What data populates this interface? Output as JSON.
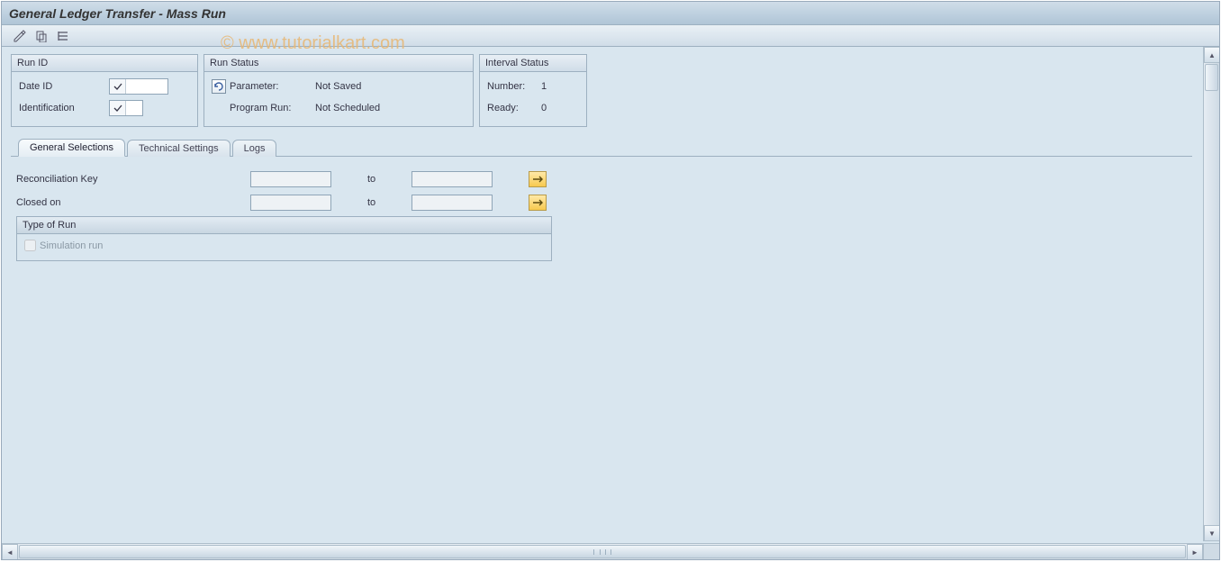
{
  "title": "General Ledger Transfer - Mass Run",
  "watermark": "© www.tutorialkart.com",
  "toolbar": {
    "icon1_name": "pencil-selection-icon",
    "icon2_name": "copy-icon",
    "icon3_name": "expand-icon"
  },
  "panels": {
    "run_id": {
      "header": "Run ID",
      "date_id_label": "Date ID",
      "date_id_value": "",
      "identification_label": "Identification",
      "identification_value": ""
    },
    "run_status": {
      "header": "Run Status",
      "parameter_label": "Parameter:",
      "parameter_value": "Not Saved",
      "program_run_label": "Program Run:",
      "program_run_value": "Not Scheduled"
    },
    "interval_status": {
      "header": "Interval Status",
      "number_label": "Number:",
      "number_value": "1",
      "ready_label": "Ready:",
      "ready_value": "0"
    }
  },
  "tabs": [
    {
      "label": "General Selections",
      "active": true
    },
    {
      "label": "Technical Settings",
      "active": false
    },
    {
      "label": "Logs",
      "active": false
    }
  ],
  "form": {
    "reconciliation_label": "Reconciliation Key",
    "reconciliation_from": "",
    "reconciliation_to": "",
    "to_label": "to",
    "closed_on_label": "Closed on",
    "closed_on_from": "",
    "closed_on_to": "",
    "type_of_run_header": "Type of Run",
    "simulation_label": "Simulation run",
    "simulation_checked": false
  }
}
